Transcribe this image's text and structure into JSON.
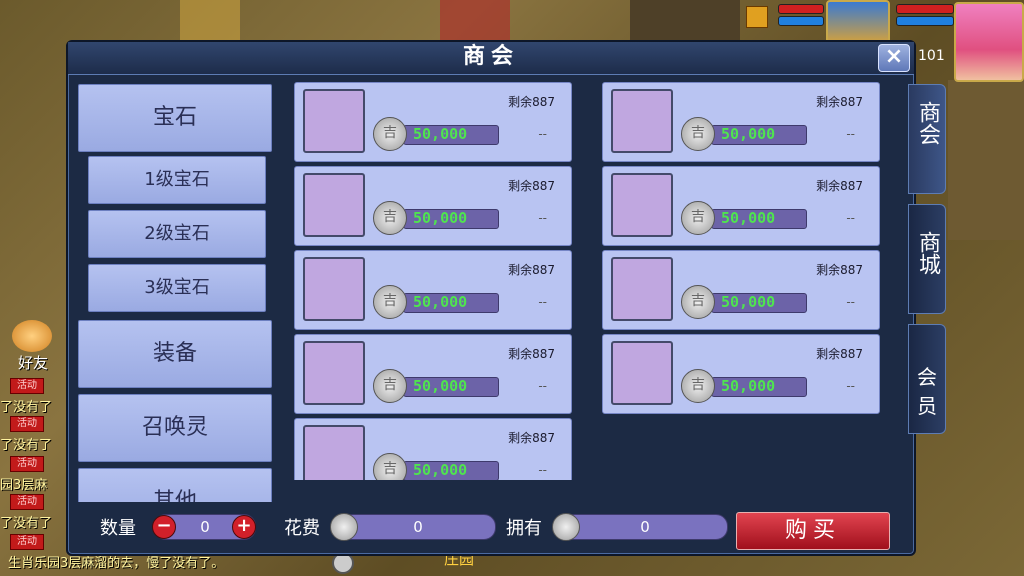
{
  "panel": {
    "title": "商会",
    "close_icon": "×"
  },
  "categories": [
    {
      "label": "宝石",
      "kind": "main"
    },
    {
      "label": "1级宝石",
      "kind": "sub"
    },
    {
      "label": "2级宝石",
      "kind": "sub"
    },
    {
      "label": "3级宝石",
      "kind": "sub"
    },
    {
      "label": "装备",
      "kind": "main"
    },
    {
      "label": "召唤灵",
      "kind": "main"
    },
    {
      "label": "其他",
      "kind": "main"
    }
  ],
  "goods": [
    {
      "remain": "剩余887",
      "price": "50,000",
      "dash": "--"
    },
    {
      "remain": "剩余887",
      "price": "50,000",
      "dash": "--"
    },
    {
      "remain": "剩余887",
      "price": "50,000",
      "dash": "--"
    },
    {
      "remain": "剩余887",
      "price": "50,000",
      "dash": "--"
    },
    {
      "remain": "剩余887",
      "price": "50,000",
      "dash": "--"
    },
    {
      "remain": "剩余887",
      "price": "50,000",
      "dash": "--"
    },
    {
      "remain": "剩余887",
      "price": "50,000",
      "dash": "--"
    },
    {
      "remain": "剩余887",
      "price": "50,000",
      "dash": "--"
    },
    {
      "remain": "剩余887",
      "price": "50,000",
      "dash": "--"
    }
  ],
  "bottom": {
    "qty_label": "数量",
    "qty_value": "0",
    "minus": "−",
    "plus": "+",
    "cost_label": "花费",
    "cost_value": "0",
    "own_label": "拥有",
    "own_value": "0",
    "buy_label": "购买"
  },
  "tabs": [
    "商会",
    "商城",
    "会员"
  ],
  "hud": {
    "level": "101"
  },
  "friends": {
    "label": "好友"
  },
  "chat": {
    "activity_tag": "活动",
    "lines": [
      "了没有了",
      "了没有了",
      "园3层麻",
      "了没有了",
      "生肖乐园3层麻溜的去，慢了没有了。"
    ],
    "location": "庄园"
  },
  "colors": {
    "panel_bg": "#1c2a44",
    "price_green": "#4fe44f",
    "buy_red": "#c81c2a"
  }
}
